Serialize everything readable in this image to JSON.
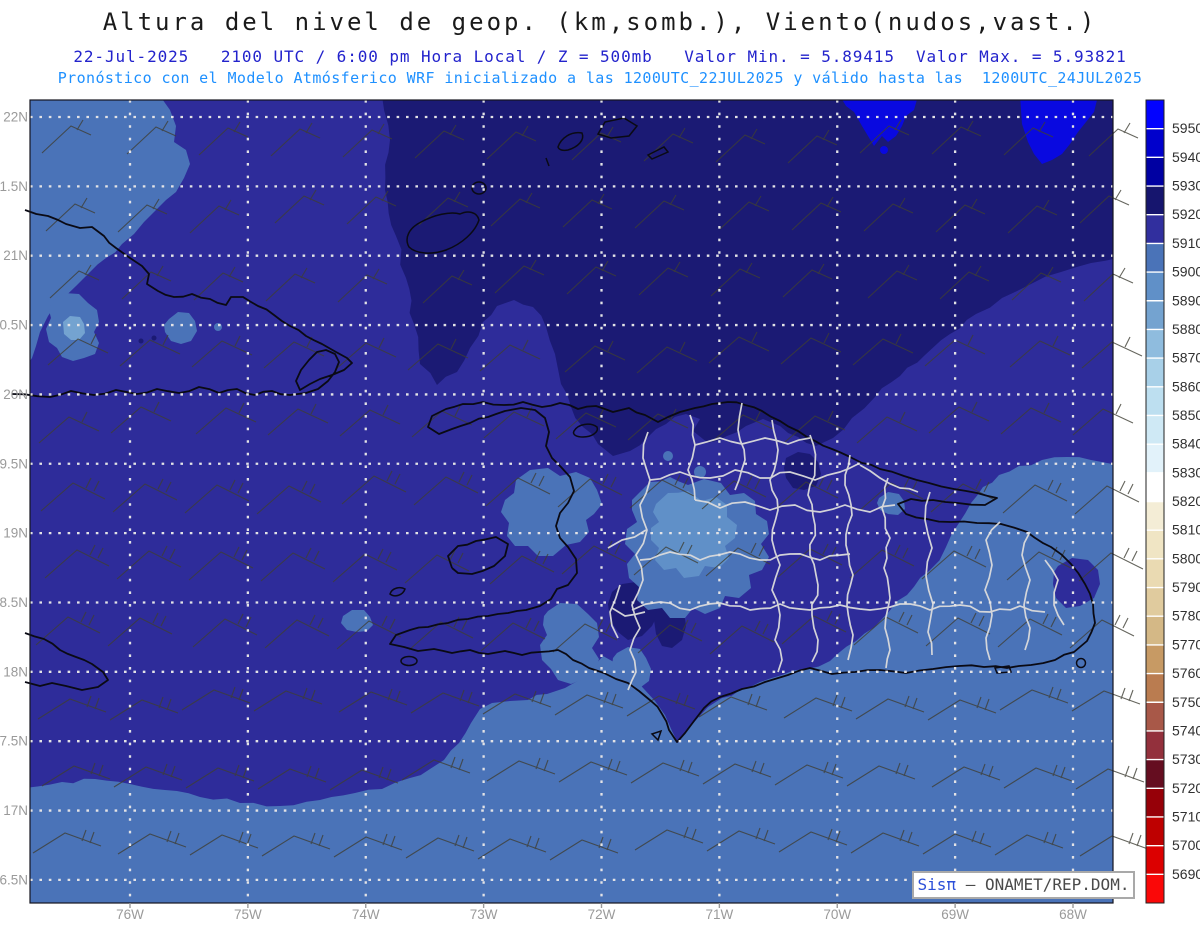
{
  "header": {
    "title": "Altura del nivel de geop. (km,somb.), Viento(nudos,vast.)",
    "subtitle1": "22-Jul-2025   2100 UTC / 6:00 pm Hora Local / Z = 500mb   Valor Min. = 5.89415  Valor Max. = 5.93821",
    "subtitle2": "Pronóstico con el Modelo Atmósferico WRF inicializado a las 1200UTC_22JUL2025 y válido hasta las  1200UTC_24JUL2025",
    "values": {
      "min": "5.89415",
      "max": "5.93821",
      "level": "500mb",
      "valid_init": "1200UTC_22JUL2025",
      "valid_until": "1200UTC_24JUL2025"
    }
  },
  "axes": {
    "lat_labels": [
      "22N",
      "1.5N",
      "21N",
      "0.5N",
      "20N",
      "9.5N",
      "19N",
      "8.5N",
      "18N",
      "7.5N",
      "17N",
      "6.5N"
    ],
    "lon_labels": [
      "76W",
      "75W",
      "74W",
      "73W",
      "72W",
      "71W",
      "70W",
      "69W",
      "68W"
    ],
    "label_color": "#9a9a9a"
  },
  "colorbar": {
    "labels_top_to_bottom": [
      "5950",
      "5940",
      "5930",
      "5920",
      "5910",
      "5900",
      "5890",
      "5880",
      "5870",
      "5860",
      "5850",
      "5840",
      "5830",
      "5820",
      "5810",
      "5800",
      "5790",
      "5780",
      "5770",
      "5760",
      "5750",
      "5740",
      "5730",
      "5720",
      "5710",
      "5700",
      "5690"
    ],
    "colors_top_to_bottom": [
      "#0202ff",
      "#0000cc",
      "#0000a2",
      "#16156e",
      "#312f9e",
      "#4a73b8",
      "#6090c8",
      "#74a3d0",
      "#8fbcde",
      "#a8d0e8",
      "#bddff0",
      "#cfe9f5",
      "#e2f2fa",
      "#ffffff",
      "#f4edd6",
      "#f0e5c4",
      "#eadab2",
      "#e0cb9e",
      "#d4b886",
      "#c79a64",
      "#ba7c50",
      "#a85848",
      "#93303c",
      "#650d20",
      "#960008",
      "#be0000",
      "#dc0000",
      "#fa0808"
    ],
    "label_color": "#303030"
  },
  "map_bands": {
    "5880-5890": "#74a3d0",
    "5890-5900": "#6090c8",
    "5900-5910": "#4a73b8",
    "5910-5920": "#2e2c9a",
    "5920-5930": "#1b1a74",
    "5930-5940": "#0909e0"
  },
  "wind": {
    "cols": 15,
    "col_x_start": 72,
    "col_x_step": 74,
    "rows": 11,
    "row_y_start": 143,
    "row_y_step": 70,
    "row_variants": [
      "north",
      "north",
      "north",
      "mid1",
      "mid1",
      "mid2",
      "mid2",
      "mid2",
      "flat",
      "flat",
      "flat"
    ],
    "barb_color": "#3f3f35"
  },
  "grid": {
    "dot_color": "#e3e3e6"
  },
  "credit": {
    "sys": "Sisπ",
    "text": " – ONAMET/REP.DOM."
  }
}
